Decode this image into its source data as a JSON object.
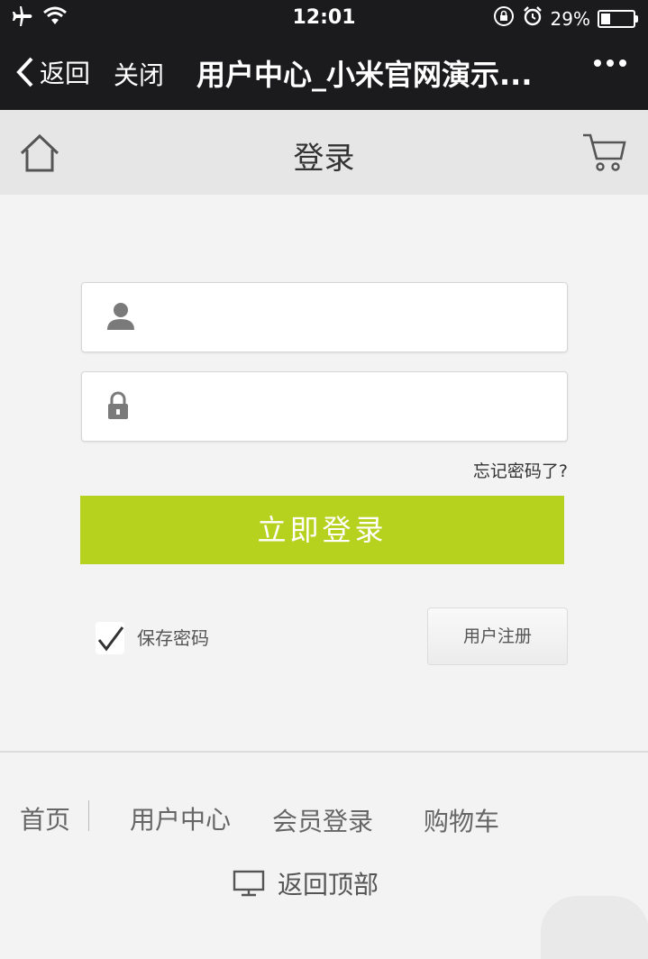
{
  "status_bar": {
    "time": "12:01",
    "battery_percent_text": "29%",
    "battery_level": 0.29,
    "icons": [
      "airplane-mode-icon",
      "wifi-icon",
      "rotation-lock-icon",
      "alarm-icon",
      "battery-icon"
    ]
  },
  "nav": {
    "back_label": "返回",
    "close_label": "关闭",
    "title": "用户中心_小米官网演示..."
  },
  "header": {
    "title": "登录"
  },
  "form": {
    "username_value": "",
    "password_value": "",
    "forgot_label": "忘记密码了?",
    "login_label": "立即登录",
    "save_password_label": "保存密码",
    "save_password_checked": true,
    "register_label": "用户注册"
  },
  "colors": {
    "primary_button": "#b7d21e",
    "top_bar": "#1b1b1d",
    "header_bg": "#e6e6e6"
  },
  "footer": {
    "links": [
      "首页",
      "用户中心",
      "会员登录",
      "购物车"
    ],
    "back_to_top": "返回顶部"
  }
}
